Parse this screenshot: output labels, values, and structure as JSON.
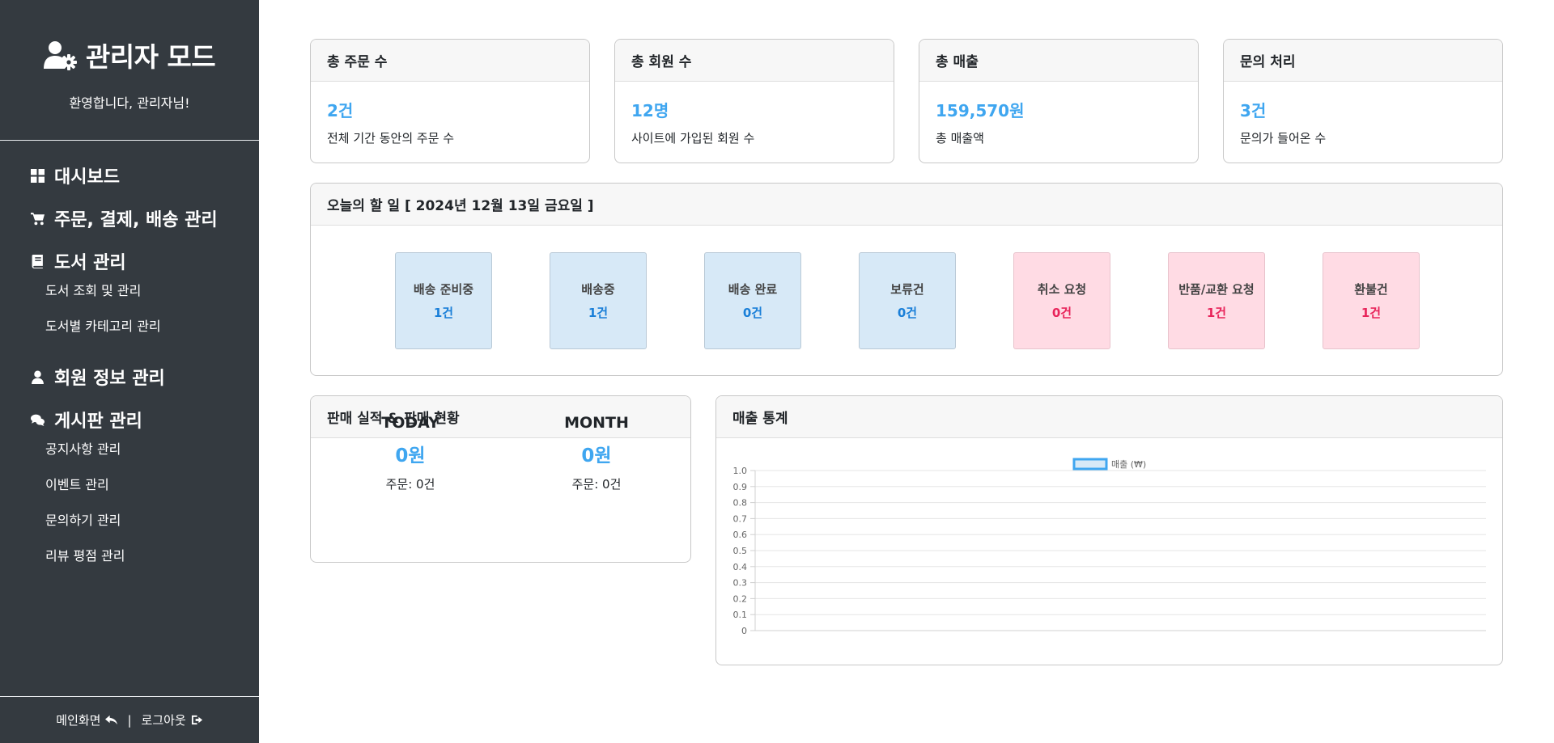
{
  "sidebar": {
    "title": "관리자 모드",
    "welcome": "환영합니다, 관리자님!",
    "nav": {
      "dashboard": "대시보드",
      "orders": "주문, 결제, 배송 관리",
      "books": "도서 관리",
      "books_sub": [
        "도서 조회 및 관리",
        "도서별 카테고리 관리"
      ],
      "members": "회원 정보 관리",
      "board": "게시판 관리",
      "board_sub": [
        "공지사항 관리",
        "이벤트 관리",
        "문의하기 관리",
        "리뷰 평점 관리"
      ]
    },
    "footer": {
      "main": "메인화면",
      "separator": "|",
      "logout": "로그아웃"
    }
  },
  "stats": [
    {
      "title": "총 주문 수",
      "value": "2건",
      "desc": "전체 기간 동안의 주문 수"
    },
    {
      "title": "총 회원 수",
      "value": "12명",
      "desc": "사이트에 가입된 회원 수"
    },
    {
      "title": "총 매출",
      "value": "159,570원",
      "desc": "총 매출액"
    },
    {
      "title": "문의 처리",
      "value": "3건",
      "desc": "문의가 들어온 수"
    }
  ],
  "todo": {
    "title": "오늘의 할 일 [ 2024년 12월 13일 금요일 ]",
    "items": [
      {
        "label": "배송 준비중",
        "count": "1건",
        "tone": "blue"
      },
      {
        "label": "배송중",
        "count": "1건",
        "tone": "blue"
      },
      {
        "label": "배송 완료",
        "count": "0건",
        "tone": "blue"
      },
      {
        "label": "보류건",
        "count": "0건",
        "tone": "blue"
      },
      {
        "label": "취소 요청",
        "count": "0건",
        "tone": "pink"
      },
      {
        "label": "반품/교환 요청",
        "count": "1건",
        "tone": "pink"
      },
      {
        "label": "환불건",
        "count": "1건",
        "tone": "pink"
      }
    ]
  },
  "performance": {
    "title": "판매 실적 & 판매 현황",
    "today": {
      "label": "TODAY",
      "amount": "0원",
      "orders": "주문: 0건"
    },
    "month": {
      "label": "MONTH",
      "amount": "0원",
      "orders": "주문: 0건"
    }
  },
  "sales_chart": {
    "title": "매출 통계"
  },
  "chart_data": {
    "type": "bar",
    "title": "",
    "categories": [],
    "series": [
      {
        "name": "매출 (₩)",
        "values": []
      }
    ],
    "ylim": [
      0,
      1.0
    ],
    "yticks": [
      "0",
      "0.1",
      "0.2",
      "0.3",
      "0.4",
      "0.5",
      "0.6",
      "0.7",
      "0.8",
      "0.9",
      "1.0"
    ],
    "legend": "top-center",
    "grid": true,
    "colors": {
      "series_fill": "#d7e9f7",
      "series_border": "#3fa6f0"
    }
  },
  "colors": {
    "sidebar_bg": "#343a40",
    "accent": "#3fa6f0",
    "todo_blue": "#d7e9f7",
    "todo_pink": "#ffdbe4",
    "count_blue": "#1a7fd8",
    "count_pink": "#e8245a"
  }
}
